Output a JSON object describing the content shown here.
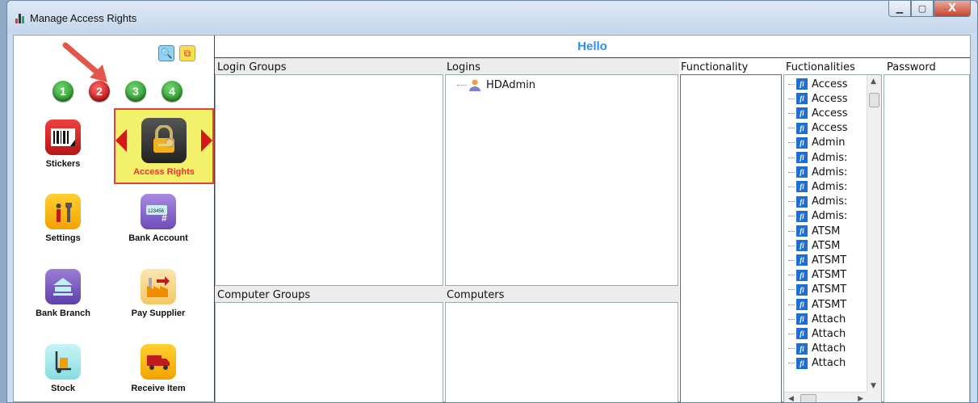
{
  "window": {
    "title": "Manage Access Rights",
    "minimize_icon": "minimize-icon",
    "maximize_icon": "maximize-icon",
    "close_label": "X"
  },
  "left_panel": {
    "steps": [
      "1",
      "2",
      "3",
      "4"
    ],
    "step_colors": [
      "#1b8b1b",
      "#b30000",
      "#1b8b1b",
      "#1b8b1b"
    ],
    "selected_step": "2",
    "tiles": [
      {
        "label": "Stickers",
        "icon": "barcode-icon"
      },
      {
        "label": "Access Rights",
        "icon": "padlock-key-icon"
      },
      {
        "label": "Settings",
        "icon": "tools-icon"
      },
      {
        "label": "Bank Account",
        "icon": "bank-card-icon"
      },
      {
        "label": "Bank Branch",
        "icon": "bank-building-icon"
      },
      {
        "label": "Pay Supplier",
        "icon": "factory-icon"
      },
      {
        "label": "Stock",
        "icon": "hand-truck-icon"
      },
      {
        "label": "Receive Item",
        "icon": "delivery-truck-icon"
      }
    ]
  },
  "main": {
    "header": "Hello",
    "columns": {
      "login_groups": "Login Groups",
      "logins": "Logins",
      "functionality": "Functionality",
      "fuctionalities": "Fuctionalities",
      "password": "Password",
      "computer_groups": "Computer Groups",
      "computers": "Computers"
    },
    "logins": [
      "HDAdmin"
    ],
    "functionalities": [
      "Access",
      "Access",
      "Access",
      "Access",
      "Admin",
      "Admis:",
      "Admis:",
      "Admis:",
      "Admis:",
      "Admis:",
      "ATSM",
      "ATSM",
      "ATSMT",
      "ATSMT",
      "ATSMT",
      "ATSMT",
      "Attach",
      "Attach",
      "Attach",
      "Attach"
    ]
  },
  "colors": {
    "accent_blue": "#2e8ff0",
    "selected_tile_bg": "#f3f06a",
    "selected_tile_border": "#e0433c"
  }
}
